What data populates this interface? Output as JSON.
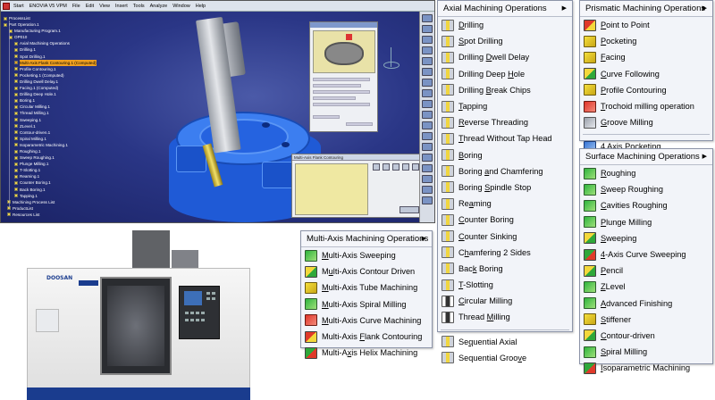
{
  "catia": {
    "menu_labels": [
      "Start",
      "ENOVIA V5 VPM",
      "File",
      "Edit",
      "View",
      "Insert",
      "Tools",
      "Analyze",
      "Window",
      "Help"
    ],
    "tree_rows": [
      "ProcessList",
      "Part Operation.1",
      "Manufacturing Program.1",
      "OP010",
      "Axial Machining Operations",
      "Drilling.1",
      "Spot Drilling.1",
      "Multi-Axis Flank Contouring.1 (Computed)",
      "Profile Contouring.1",
      "Pocketing.1 (Computed)",
      "Drilling Dwell Delay.1",
      "Facing.1 (Computed)",
      "Drilling Deep Hole.1",
      "Boring.1",
      "Circular Milling.1",
      "Thread Milling.1",
      "Sweeping.1",
      "ZLevel.1",
      "Contour-driven.1",
      "Spiral Milling.1",
      "Isoparametric Machining.1",
      "Roughing.1",
      "Sweep Roughing.1",
      "Plunge Milling.1",
      "T-Slotting.1",
      "Reaming.1",
      "Counter Boring.1",
      "Back Boring.1",
      "Tapping.1",
      "Machining Process List",
      "ProductList",
      "Resources List"
    ],
    "dialog_title": "Multi-Axis Flank Contouring",
    "dialog2_title": "Multi-Axis Flank Contouring"
  },
  "machine": {
    "brand": "DOOSAN"
  },
  "menus": {
    "multi_axis": {
      "title": "Multi-Axis Machining Operations",
      "items": [
        {
          "pre": "",
          "u": "M",
          "post": "ulti-Axis Sweeping",
          "icon": "green"
        },
        {
          "pre": "M",
          "u": "u",
          "post": "lti-Axis Contour Driven",
          "icon": "mix"
        },
        {
          "pre": "",
          "u": "M",
          "post": "ulti-Axis Tube Machining",
          "icon": "yellow"
        },
        {
          "pre": "",
          "u": "M",
          "post": "ulti-Axis Spiral Milling",
          "icon": "green"
        },
        {
          "pre": "",
          "u": "M",
          "post": "ulti-Axis Curve Machining",
          "icon": "red"
        },
        {
          "pre": "Multi-Axis ",
          "u": "F",
          "post": "lank Contouring",
          "icon": "mix2"
        },
        {
          "pre": "Multi-A",
          "u": "x",
          "post": "is Helix Machining",
          "icon": "mix3"
        }
      ]
    },
    "axial": {
      "title": "Axial Machining Operations",
      "items": [
        {
          "pre": "",
          "u": "D",
          "post": "rilling",
          "icon": "drill"
        },
        {
          "pre": "",
          "u": "S",
          "post": "pot Drilling",
          "icon": "drill"
        },
        {
          "pre": "Drilling ",
          "u": "D",
          "post": "well Delay",
          "icon": "drill"
        },
        {
          "pre": "Drilling Deep ",
          "u": "H",
          "post": "ole",
          "icon": "drill"
        },
        {
          "pre": "Drilling ",
          "u": "B",
          "post": "reak Chips",
          "icon": "drill"
        },
        {
          "pre": "",
          "u": "T",
          "post": "apping",
          "icon": "drill"
        },
        {
          "pre": "",
          "u": "R",
          "post": "everse Threading",
          "icon": "drill"
        },
        {
          "pre": "",
          "u": "T",
          "post": "hread Without Tap Head",
          "icon": "drill"
        },
        {
          "pre": "",
          "u": "B",
          "post": "oring",
          "icon": "drill"
        },
        {
          "pre": "Boring ",
          "u": "a",
          "post": "nd Chamfering",
          "icon": "drill"
        },
        {
          "pre": "Boring ",
          "u": "S",
          "post": "pindle Stop",
          "icon": "drill"
        },
        {
          "pre": "Re",
          "u": "a",
          "post": "ming",
          "icon": "drill"
        },
        {
          "pre": "",
          "u": "C",
          "post": "ounter Boring",
          "icon": "drill"
        },
        {
          "pre": "",
          "u": "C",
          "post": "ounter Sinking",
          "icon": "drill"
        },
        {
          "pre": "C",
          "u": "h",
          "post": "amfering 2 Sides",
          "icon": "drill"
        },
        {
          "pre": "Bac",
          "u": "k",
          "post": " Boring",
          "icon": "drill"
        },
        {
          "pre": "",
          "u": "T",
          "post": "-Slotting",
          "icon": "drill"
        },
        {
          "pre": "",
          "u": "C",
          "post": "ircular Milling",
          "icon": "dark"
        },
        {
          "pre": "Thread ",
          "u": "M",
          "post": "illing",
          "icon": "dark"
        }
      ],
      "items2": [
        {
          "pre": "Se",
          "u": "q",
          "post": "uential Axial",
          "icon": "drill"
        },
        {
          "pre": "Sequential Groo",
          "u": "v",
          "post": "e",
          "icon": "drill"
        }
      ]
    },
    "prismatic": {
      "title": "Prismatic Machining Operations",
      "items": [
        {
          "pre": "",
          "u": "P",
          "post": "oint to Point",
          "icon": "mix2"
        },
        {
          "pre": "",
          "u": "P",
          "post": "ocketing",
          "icon": "yellow"
        },
        {
          "pre": "",
          "u": "F",
          "post": "acing",
          "icon": "yellow"
        },
        {
          "pre": "",
          "u": "C",
          "post": "urve Following",
          "icon": "mix"
        },
        {
          "pre": "",
          "u": "P",
          "post": "rofile Contouring",
          "icon": "yellow"
        },
        {
          "pre": "",
          "u": "T",
          "post": "rochoid milling operation",
          "icon": "red"
        },
        {
          "pre": "",
          "u": "G",
          "post": "roove Milling",
          "icon": "grey"
        }
      ],
      "items2": [
        {
          "pre": "",
          "u": "4",
          "post": " Axis Pocketing",
          "icon": "blue"
        }
      ]
    },
    "surface": {
      "title": "Surface Machining Operations",
      "items": [
        {
          "pre": "",
          "u": "R",
          "post": "oughing",
          "icon": "green"
        },
        {
          "pre": "",
          "u": "S",
          "post": "weep Roughing",
          "icon": "green"
        },
        {
          "pre": "",
          "u": "C",
          "post": "avities Roughing",
          "icon": "green"
        },
        {
          "pre": "",
          "u": "P",
          "post": "lunge Milling",
          "icon": "green"
        },
        {
          "pre": "",
          "u": "S",
          "post": "weeping",
          "icon": "mix"
        },
        {
          "pre": "",
          "u": "4",
          "post": "-Axis Curve Sweeping",
          "icon": "mix3"
        },
        {
          "pre": "",
          "u": "P",
          "post": "encil",
          "icon": "mix"
        },
        {
          "pre": "",
          "u": "Z",
          "post": "Level",
          "icon": "green"
        },
        {
          "pre": "",
          "u": "A",
          "post": "dvanced Finishing",
          "icon": "green"
        },
        {
          "pre": "",
          "u": "S",
          "post": "tiffener",
          "icon": "yellow"
        },
        {
          "pre": "",
          "u": "C",
          "post": "ontour-driven",
          "icon": "mix"
        },
        {
          "pre": "",
          "u": "S",
          "post": "piral Milling",
          "icon": "green"
        },
        {
          "pre": "",
          "u": "I",
          "post": "soparametric Machining",
          "icon": "mix3"
        }
      ]
    }
  }
}
